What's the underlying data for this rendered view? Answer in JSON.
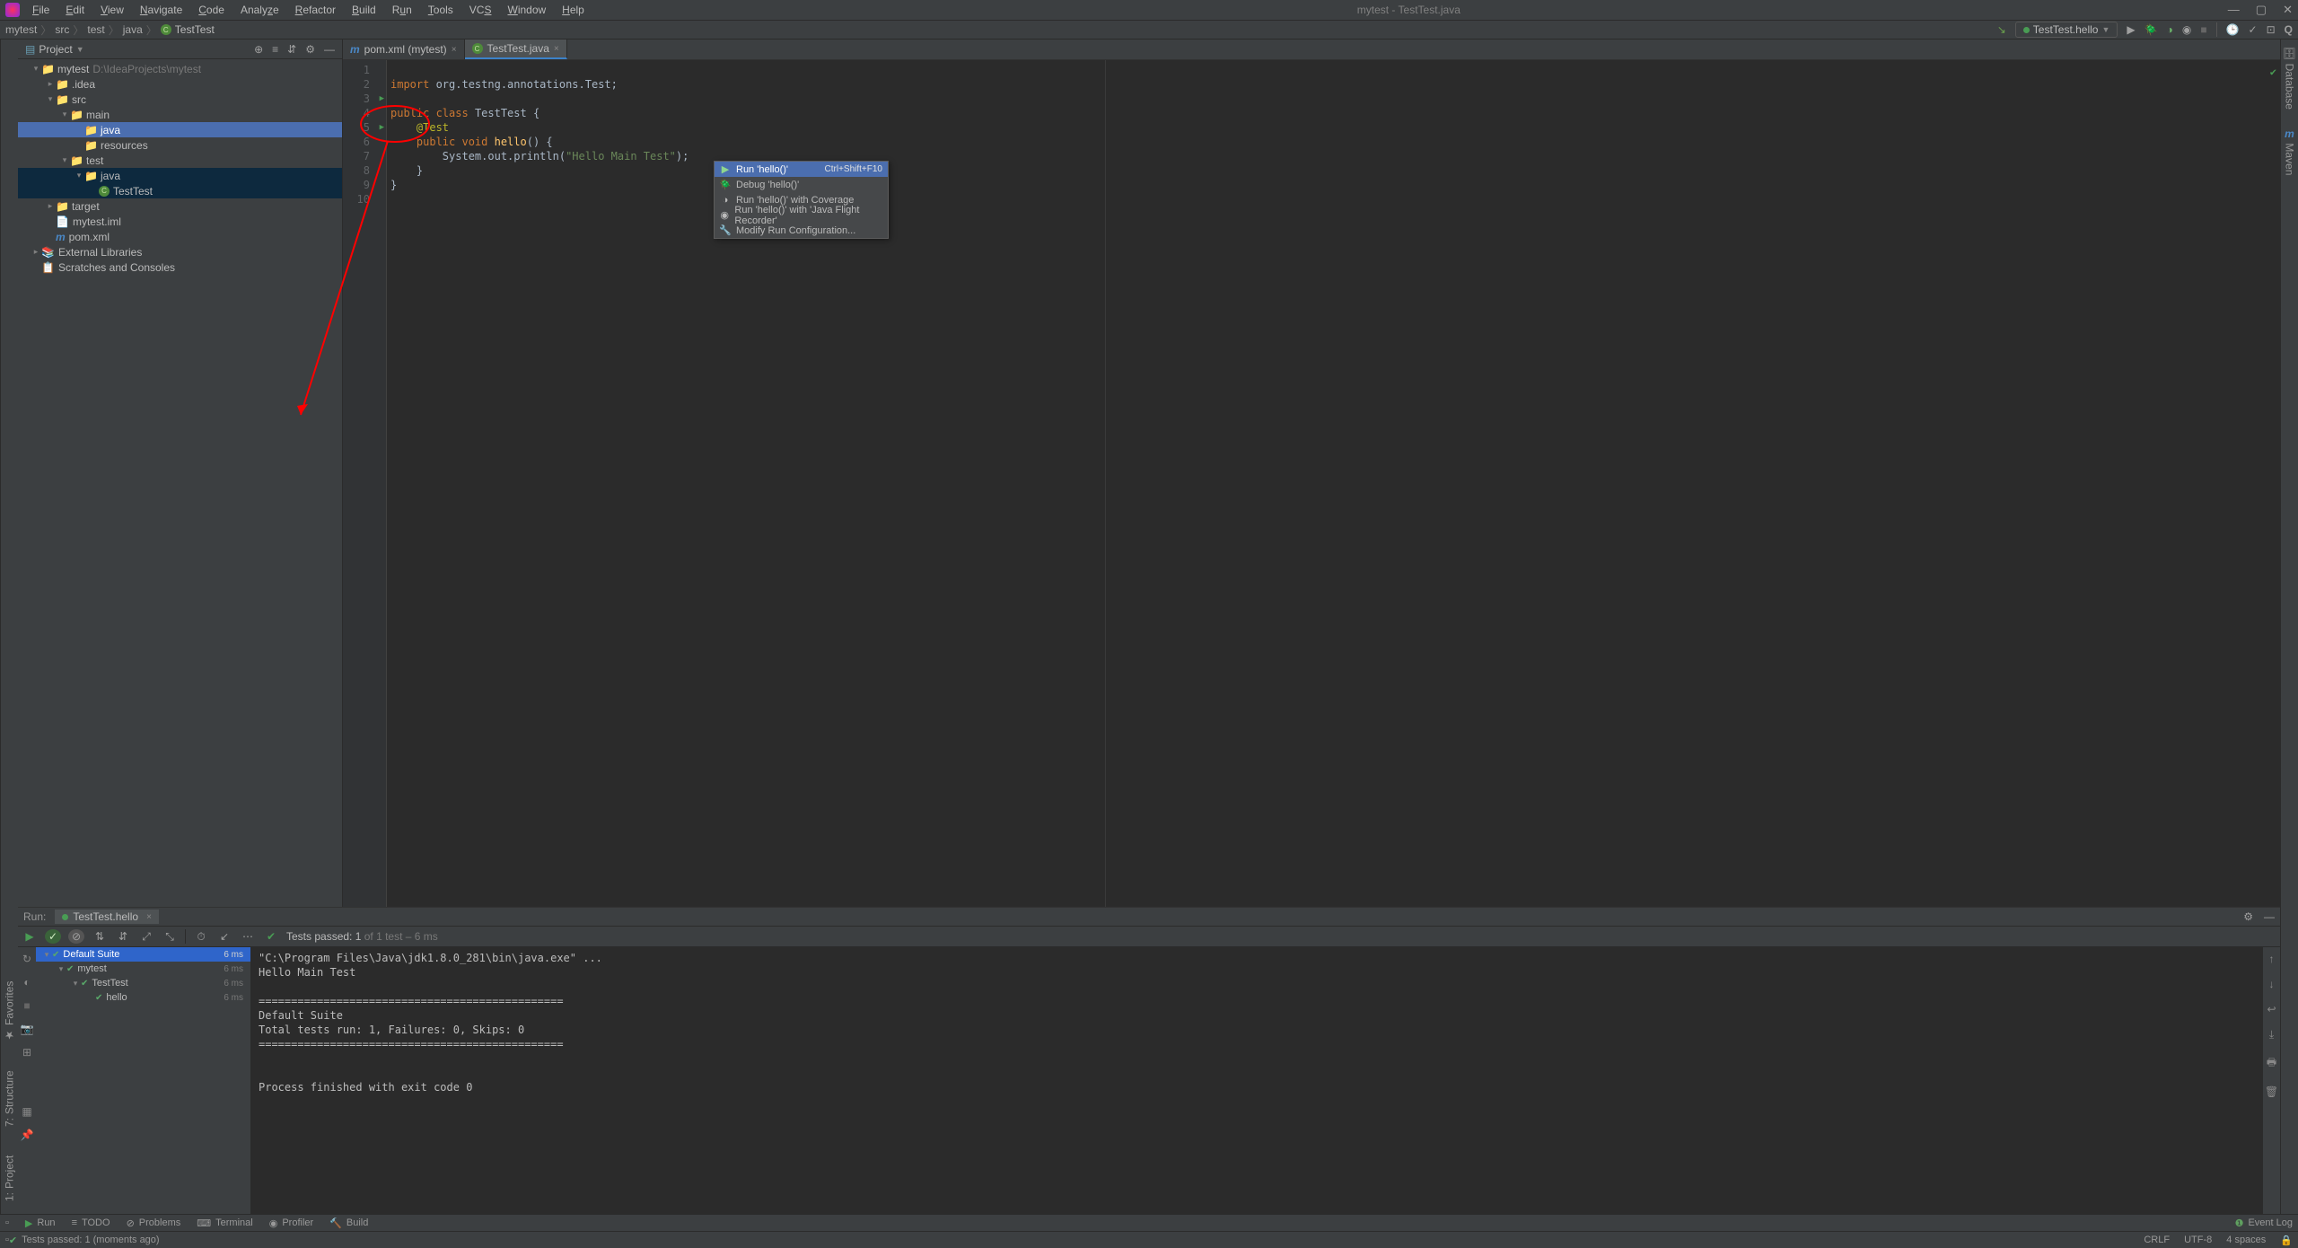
{
  "window": {
    "title": "mytest - TestTest.java"
  },
  "menu": [
    "File",
    "Edit",
    "View",
    "Navigate",
    "Code",
    "Analyze",
    "Refactor",
    "Build",
    "Run",
    "Tools",
    "VCS",
    "Window",
    "Help"
  ],
  "breadcrumb": [
    "mytest",
    "src",
    "test",
    "java",
    "TestTest"
  ],
  "nav_right": {
    "run_config": "TestTest.hello"
  },
  "project_panel": {
    "title": "Project",
    "tree": {
      "root": {
        "name": "mytest",
        "path": "D:\\IdeaProjects\\mytest"
      },
      "idea": ".idea",
      "src": "src",
      "main": "main",
      "main_java": "java",
      "main_resources": "resources",
      "test": "test",
      "test_java": "java",
      "test_class": "TestTest",
      "target": "target",
      "iml": "mytest.iml",
      "pom": "pom.xml",
      "ext": "External Libraries",
      "scratch": "Scratches and Consoles"
    }
  },
  "editor": {
    "tabs": [
      {
        "label": "pom.xml (mytest)",
        "active": false
      },
      {
        "label": "TestTest.java",
        "active": true
      }
    ],
    "code": {
      "line1": {
        "kw1": "import",
        "pkg": " org.testng.annotations.",
        "cls": "Test",
        "end": ";"
      },
      "line3": {
        "kw1": "public ",
        "kw2": "class ",
        "cls": "TestTest ",
        "br": "{"
      },
      "line4": {
        "ann": "@Test"
      },
      "line5": {
        "kw": "public void ",
        "m": "hello",
        "rest": "() {"
      },
      "line6": {
        "call": "System.out.println(",
        "str": "\"Hello Main Test\"",
        "end": ");"
      },
      "line7": "    }",
      "line8": "}"
    }
  },
  "context_menu": [
    {
      "label": "Run 'hello()'",
      "shortcut": "Ctrl+Shift+F10",
      "selected": true
    },
    {
      "label": "Debug 'hello()'"
    },
    {
      "label": "Run 'hello()' with Coverage"
    },
    {
      "label": "Run 'hello()' with 'Java Flight Recorder'"
    },
    {
      "label": "Modify Run Configuration..."
    }
  ],
  "run_panel": {
    "label": "Run:",
    "tab": "TestTest.hello",
    "status": {
      "text": "Tests passed: 1",
      "suffix": " of 1 test – 6 ms"
    },
    "tree": [
      {
        "label": "Default Suite",
        "time": "6 ms",
        "indent": 0,
        "selected": true
      },
      {
        "label": "mytest",
        "time": "6 ms",
        "indent": 1
      },
      {
        "label": "TestTest",
        "time": "6 ms",
        "indent": 2
      },
      {
        "label": "hello",
        "time": "6 ms",
        "indent": 3
      }
    ],
    "console": "\"C:\\Program Files\\Java\\jdk1.8.0_281\\bin\\java.exe\" ...\nHello Main Test\n\n===============================================\nDefault Suite\nTotal tests run: 1, Failures: 0, Skips: 0\n===============================================\n\n\nProcess finished with exit code 0\n"
  },
  "bottom_tools": {
    "run": "Run",
    "todo": "TODO",
    "problems": "Problems",
    "terminal": "Terminal",
    "profiler": "Profiler",
    "build": "Build",
    "event_log": "Event Log"
  },
  "status_bar": {
    "msg": "Tests passed: 1 (moments ago)",
    "crlf": "CRLF",
    "enc": "UTF-8",
    "indent": "4 spaces"
  },
  "right_strip": {
    "database": "Database",
    "maven": "Maven"
  },
  "left_strip": {
    "project": "Project",
    "structure": "Structure",
    "favorites": "Favorites"
  }
}
